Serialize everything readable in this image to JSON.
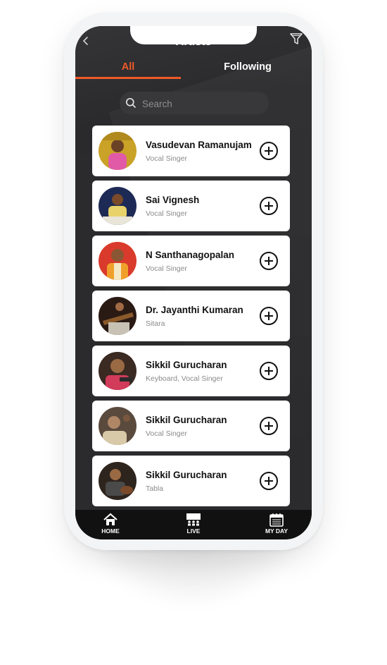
{
  "header": {
    "title": "Artists",
    "back_icon": "chevron-left-icon",
    "filter_icon": "funnel-icon"
  },
  "tabs": [
    {
      "label": "All",
      "active": true
    },
    {
      "label": "Following",
      "active": false
    }
  ],
  "search": {
    "placeholder": "Search",
    "icon": "search-icon"
  },
  "artists": [
    {
      "name": "Vasudevan Ramanujam",
      "role": "Vocal Singer"
    },
    {
      "name": "Sai Vignesh",
      "role": "Vocal Singer"
    },
    {
      "name": "N Santhanagopalan",
      "role": "Vocal Singer"
    },
    {
      "name": "Dr. Jayanthi Kumaran",
      "role": "Sitara"
    },
    {
      "name": "Sikkil Gurucharan",
      "role": "Keyboard, Vocal Singer"
    },
    {
      "name": "Sikkil Gurucharan",
      "role": "Vocal Singer"
    },
    {
      "name": "Sikkil Gurucharan",
      "role": "Tabla"
    }
  ],
  "bottom_nav": [
    {
      "label": "HOME",
      "icon": "home-icon"
    },
    {
      "label": "LIVE",
      "icon": "stage-icon"
    },
    {
      "label": "MY DAY",
      "icon": "calendar-icon"
    }
  ],
  "colors": {
    "accent": "#f05a28",
    "screen_bg": "#2b2b2d",
    "nav_bg": "#111111",
    "card_bg": "#ffffff"
  }
}
